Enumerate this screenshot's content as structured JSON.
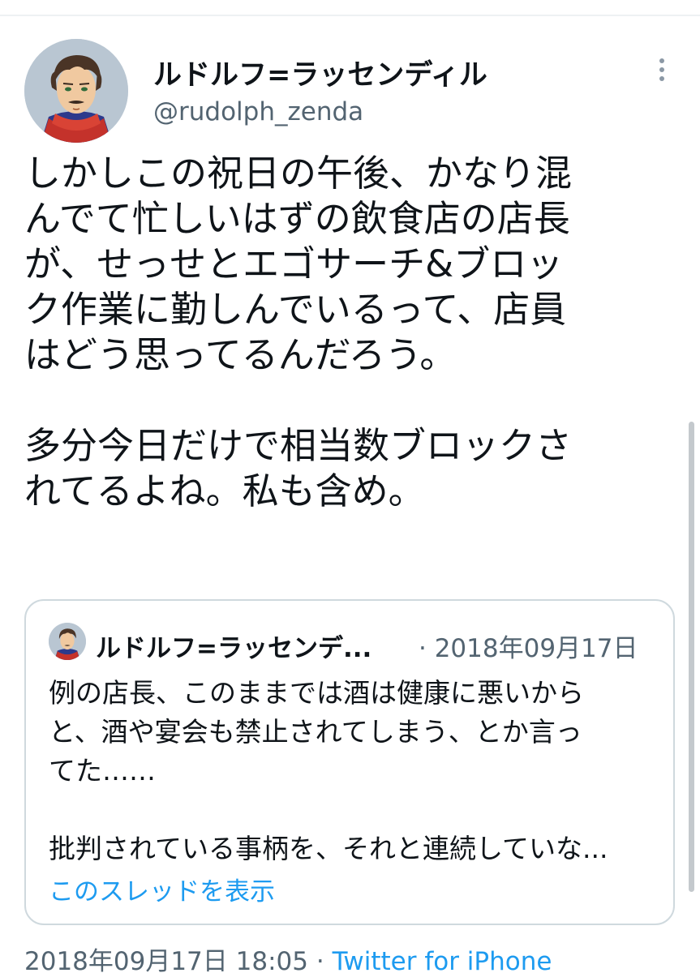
{
  "tweet": {
    "display_name": "ルドルフ=ラッセンディル",
    "handle": "@rudolph_zenda",
    "avatar_icon": "illustrated-portrait-avatar",
    "more_icon": "more-options-icon",
    "text": "しかしこの祝日の午後、かなり混\nんでて忙しいはずの飲食店の店長\nが、せっせとエゴサーチ&ブロッ\nク作業に勤しんでいるって、店員\nはどう思ってるんだろう。\n\n多分今日だけで相当数ブロックさ\nれてるよね。私も含め。",
    "timestamp": "2018年09月17日 18:05",
    "separator": "·",
    "source": "Twitter for iPhone"
  },
  "quoted_tweet": {
    "display_name": "ルドルフ=ラッセンデ...",
    "date": "· 2018年09月17日",
    "text": "例の店長、このままでは酒は健康に悪いから\nと、酒や宴会も禁止されてしまう、とか言っ\nてた……\n\n批判されている事柄を、それと連続していな...",
    "show_thread_label": "このスレッドを表示"
  },
  "colors": {
    "text_primary": "#0f1419",
    "text_secondary": "#536471",
    "link": "#1d9bf0",
    "border": "#cfd9de"
  }
}
